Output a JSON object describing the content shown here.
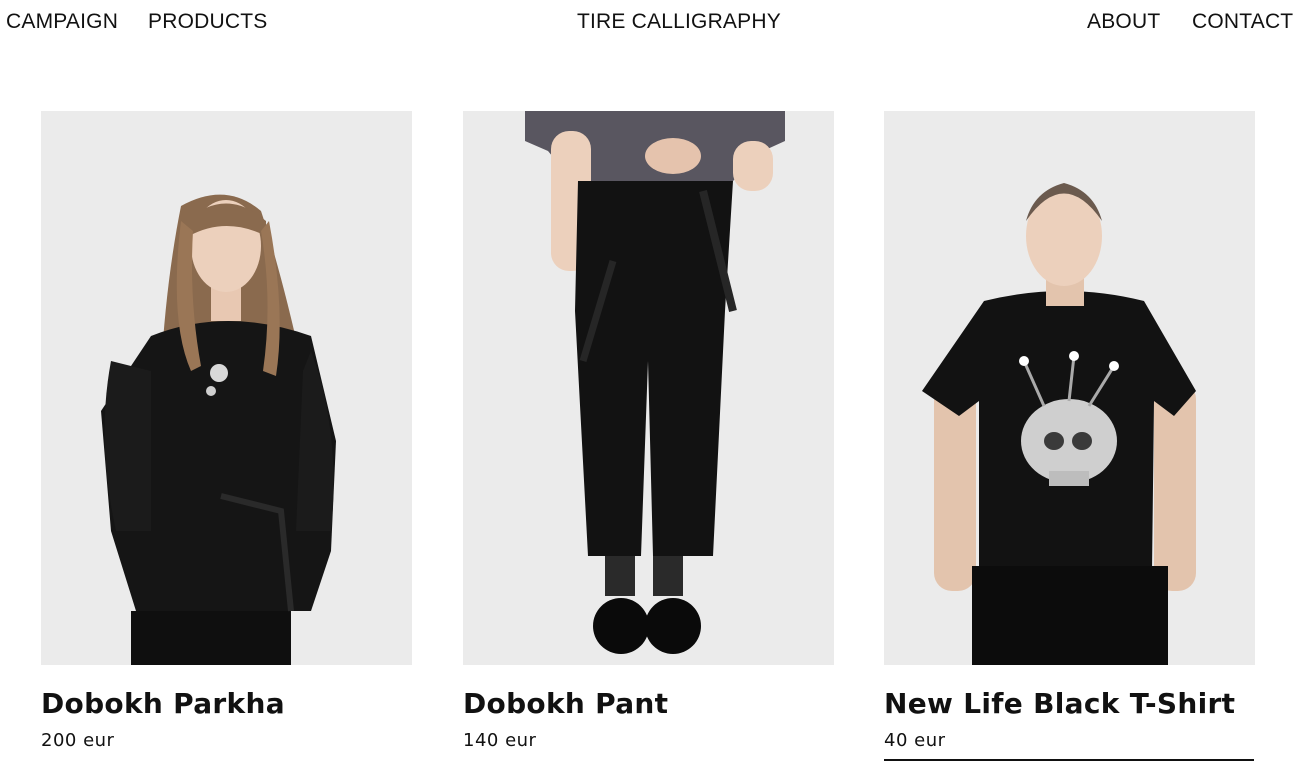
{
  "nav": {
    "campaign": "CAMPAIGN",
    "products": "PRODUCTS",
    "brand": "TIRE CALLIGRAPHY",
    "about": "ABOUT",
    "contact": "CONTACT"
  },
  "products": [
    {
      "name": "Dobokh Parkha",
      "price": "200 eur",
      "image": "model-in-black-parka-photo"
    },
    {
      "name": "Dobokh Pant",
      "price": "140 eur",
      "image": "black-cropped-pants-photo"
    },
    {
      "name": "New Life Black T-Shirt",
      "price": "40 eur",
      "image": "man-in-skull-print-tshirt-photo"
    }
  ],
  "colors": {
    "background": "#ffffff",
    "text": "#111111",
    "photo_bg": "#ebebeb"
  }
}
